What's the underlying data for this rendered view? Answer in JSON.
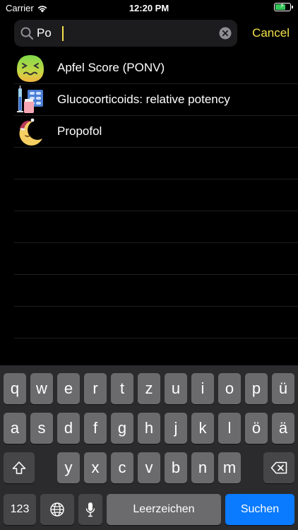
{
  "status_bar": {
    "carrier": "Carrier",
    "time": "12:20 PM",
    "battery_level": 0.75,
    "battery_color": "#34c759"
  },
  "search": {
    "value": "Po",
    "placeholder": "",
    "cancel_label": "Cancel",
    "accent_color": "#f4e04d"
  },
  "results": [
    {
      "label": "Apfel Score (PONV)",
      "icon": "nauseous-face-icon"
    },
    {
      "label": "Glucocorticoids: relative potency",
      "icon": "syringe-pills-icon"
    },
    {
      "label": "Propofol",
      "icon": "sleeping-moon-icon"
    }
  ],
  "keyboard": {
    "row1": [
      "q",
      "w",
      "e",
      "r",
      "t",
      "z",
      "u",
      "i",
      "o",
      "p",
      "ü"
    ],
    "row2": [
      "a",
      "s",
      "d",
      "f",
      "g",
      "h",
      "j",
      "k",
      "l",
      "ö",
      "ä"
    ],
    "row3": [
      "y",
      "x",
      "c",
      "v",
      "b",
      "n",
      "m"
    ],
    "numbers_label": "123",
    "space_label": "Leerzeichen",
    "return_label": "Suchen",
    "return_color": "#0a7aff"
  }
}
